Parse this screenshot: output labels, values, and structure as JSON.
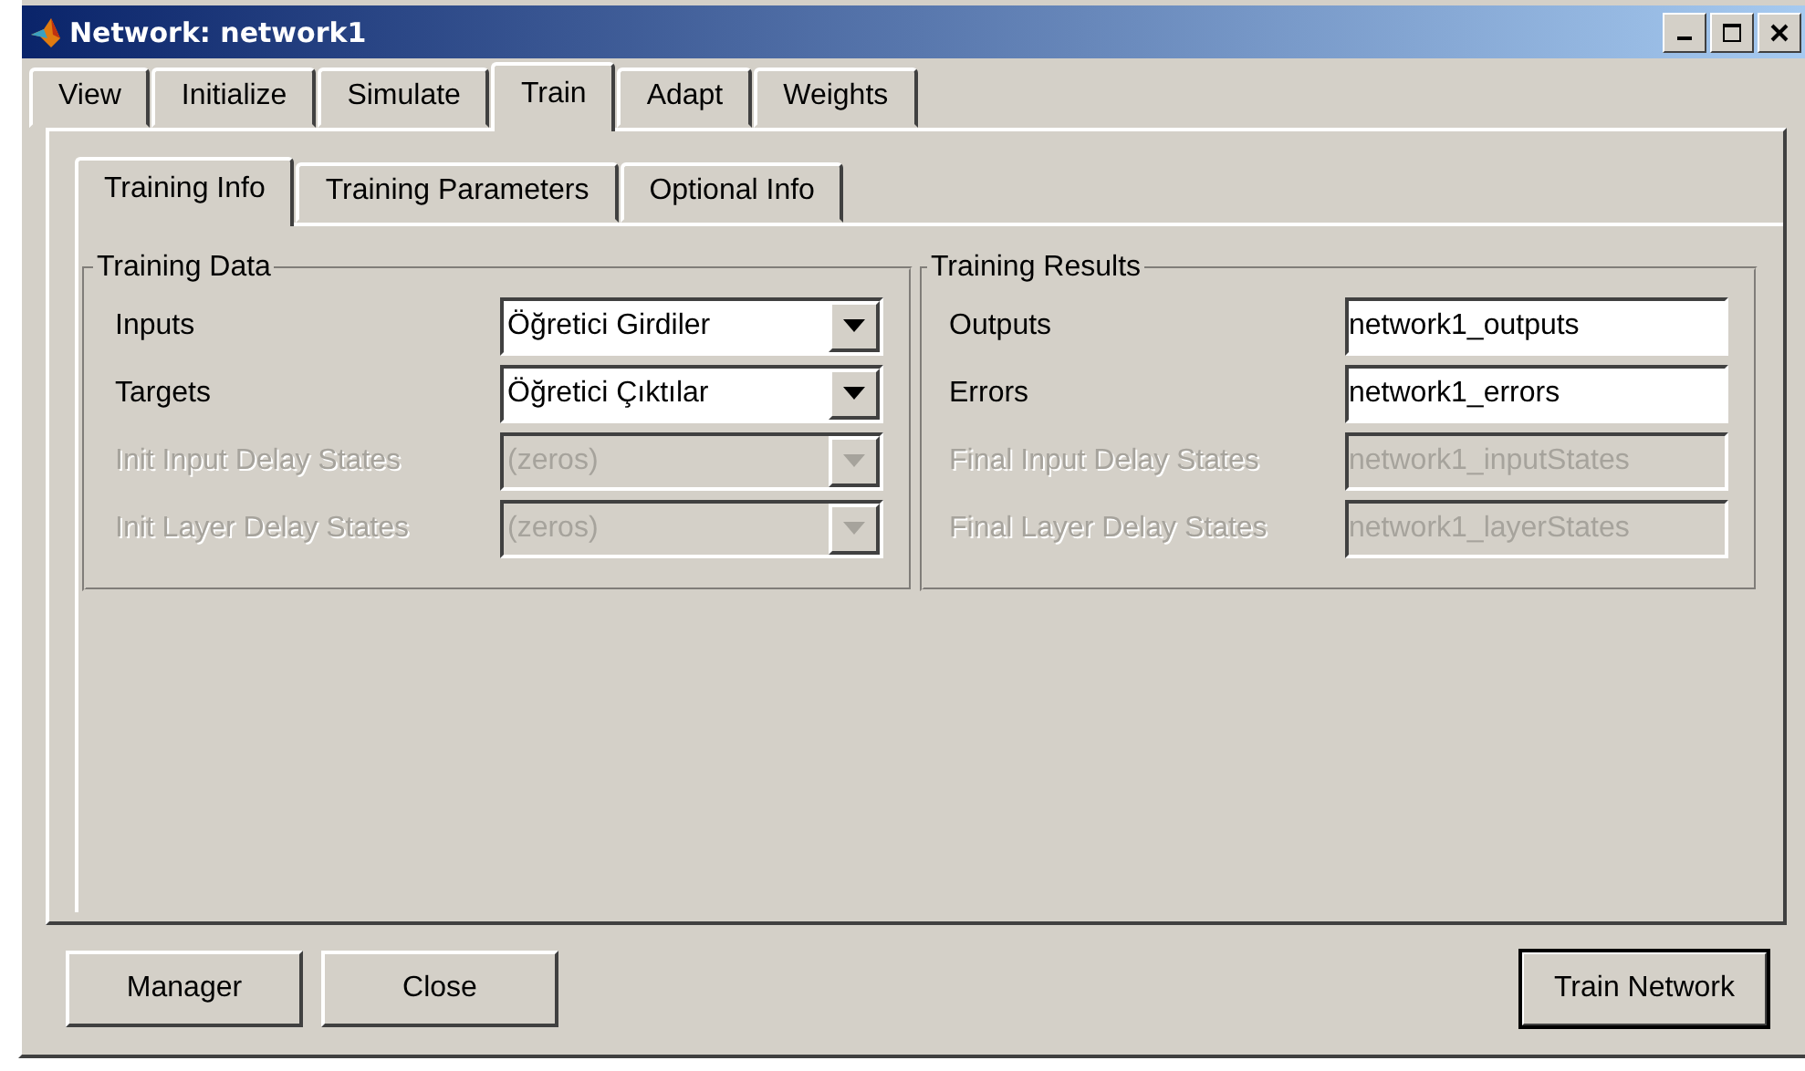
{
  "window": {
    "title": "Network: network1"
  },
  "tabs": [
    {
      "label": "View",
      "selected": false
    },
    {
      "label": "Initialize",
      "selected": false
    },
    {
      "label": "Simulate",
      "selected": false
    },
    {
      "label": "Train",
      "selected": true
    },
    {
      "label": "Adapt",
      "selected": false
    },
    {
      "label": "Weights",
      "selected": false
    }
  ],
  "subtabs": [
    {
      "label": "Training Info",
      "selected": true
    },
    {
      "label": "Training Parameters",
      "selected": false
    },
    {
      "label": "Optional Info",
      "selected": false
    }
  ],
  "groups": [
    {
      "title": "Training Data",
      "fields": [
        {
          "label": "Inputs",
          "kind": "dropdown",
          "value": "Öğretici Girdiler",
          "disabled": false
        },
        {
          "label": "Targets",
          "kind": "dropdown",
          "value": "Öğretici Çıktılar",
          "disabled": false
        },
        {
          "label": "Init Input Delay States",
          "kind": "dropdown",
          "value": "(zeros)",
          "disabled": true
        },
        {
          "label": "Init Layer Delay States",
          "kind": "dropdown",
          "value": "(zeros)",
          "disabled": true
        }
      ]
    },
    {
      "title": "Training Results",
      "fields": [
        {
          "label": "Outputs",
          "kind": "text",
          "value": "network1_outputs",
          "disabled": false
        },
        {
          "label": "Errors",
          "kind": "text",
          "value": "network1_errors",
          "disabled": false
        },
        {
          "label": "Final Input Delay States",
          "kind": "text",
          "value": "network1_inputStates",
          "disabled": true
        },
        {
          "label": "Final Layer Delay States",
          "kind": "text",
          "value": "network1_layerStates",
          "disabled": true
        }
      ]
    }
  ],
  "buttons": [
    {
      "label": "Manager",
      "focused": false
    },
    {
      "label": "Close",
      "focused": false
    },
    {
      "label": "Train Network",
      "focused": true
    }
  ]
}
